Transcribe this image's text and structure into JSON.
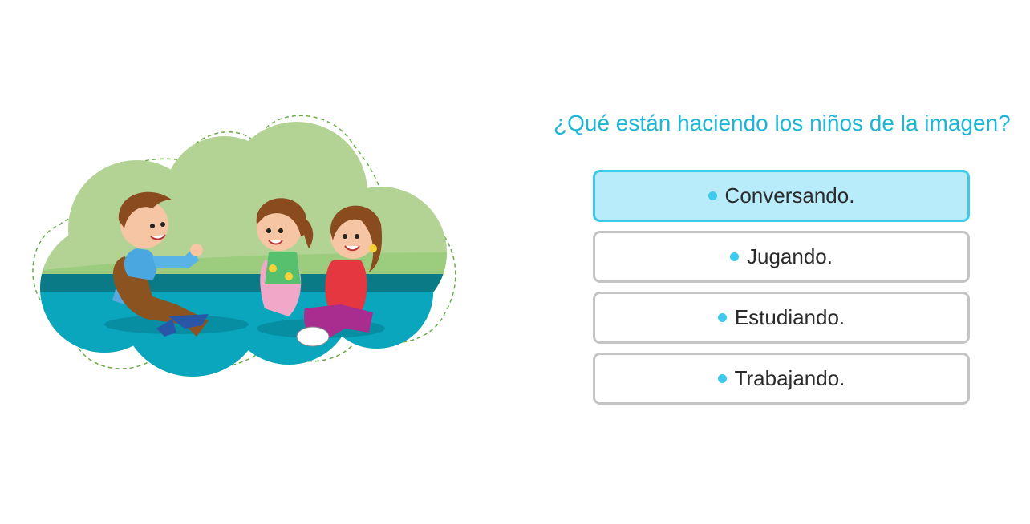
{
  "question": "¿Qué están haciendo los niños de la imagen?",
  "options": [
    {
      "label": "Conversando.",
      "selected": true
    },
    {
      "label": "Jugando.",
      "selected": false
    },
    {
      "label": "Estudiando.",
      "selected": false
    },
    {
      "label": "Trabajando.",
      "selected": false
    }
  ],
  "colors": {
    "accent": "#1fb5d6",
    "bullet": "#3ccbef",
    "selected_bg": "#b8ecfb",
    "selected_border": "#3cc9ec",
    "border": "#c4c4c4"
  }
}
